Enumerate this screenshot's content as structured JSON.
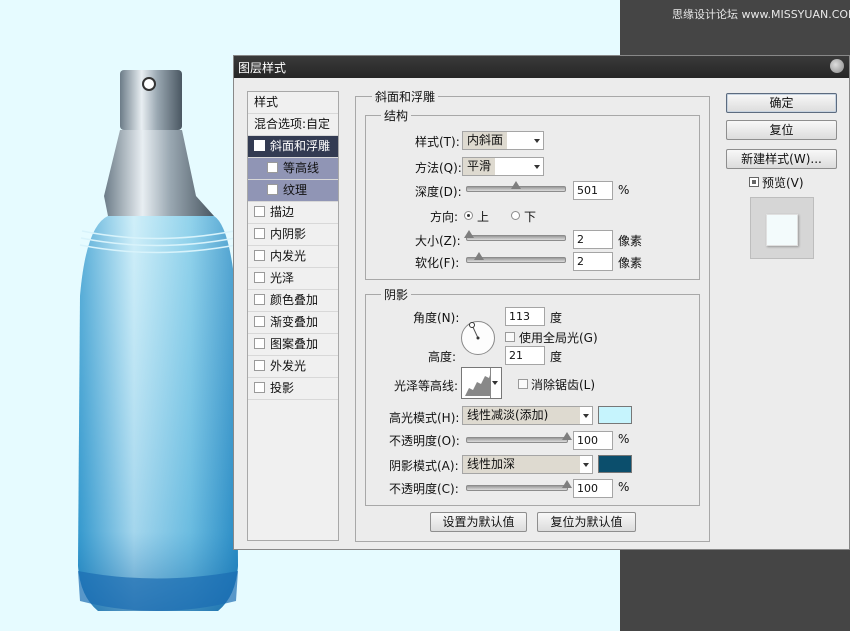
{
  "watermark": "思缘设计论坛 www.MISSYUAN.COM",
  "dialog": {
    "title": "图层样式"
  },
  "styles_panel": {
    "header": "样式",
    "blend_options": "混合选项:自定",
    "items": [
      {
        "label": "斜面和浮雕",
        "checked": true,
        "selected": true
      },
      {
        "label": "等高线",
        "checked": false,
        "sub": true
      },
      {
        "label": "纹理",
        "checked": false,
        "sub": true
      },
      {
        "label": "描边",
        "checked": false
      },
      {
        "label": "内阴影",
        "checked": false
      },
      {
        "label": "内发光",
        "checked": false
      },
      {
        "label": "光泽",
        "checked": false
      },
      {
        "label": "颜色叠加",
        "checked": false
      },
      {
        "label": "渐变叠加",
        "checked": false
      },
      {
        "label": "图案叠加",
        "checked": false
      },
      {
        "label": "外发光",
        "checked": false
      },
      {
        "label": "投影",
        "checked": false
      }
    ]
  },
  "bevel": {
    "section_title": "斜面和浮雕",
    "structure_title": "结构",
    "style_label": "样式(T):",
    "style_value": "内斜面",
    "technique_label": "方法(Q):",
    "technique_value": "平滑",
    "depth_label": "深度(D):",
    "depth_value": "501",
    "depth_unit": "%",
    "depth_slider_pct": 50,
    "direction_label": "方向:",
    "direction_up": "上",
    "direction_down": "下",
    "size_label": "大小(Z):",
    "size_value": "2",
    "size_unit": "像素",
    "size_slider_pct": 2,
    "soften_label": "软化(F):",
    "soften_value": "2",
    "soften_unit": "像素",
    "soften_slider_pct": 12
  },
  "shading": {
    "section_title": "阴影",
    "angle_label": "角度(N):",
    "angle_value": "113",
    "angle_unit": "度",
    "global_light_label": "使用全局光(G)",
    "altitude_label": "高度:",
    "altitude_value": "21",
    "altitude_unit": "度",
    "gloss_label": "光泽等高线:",
    "antialias_label": "消除锯齿(L)",
    "highlight_label": "高光模式(H):",
    "highlight_mode": "线性减淡(添加)",
    "highlight_color": "#c6f4fd",
    "highlight_opacity_label": "不透明度(O):",
    "highlight_opacity": "100",
    "opacity_unit": "%",
    "shadow_label": "阴影模式(A):",
    "shadow_mode": "线性加深",
    "shadow_color": "#0b4e6c",
    "shadow_opacity_label": "不透明度(C):",
    "shadow_opacity": "100"
  },
  "buttons": {
    "set_default": "设置为默认值",
    "reset_default": "复位为默认值",
    "ok": "确定",
    "reset": "复位",
    "new_style": "新建样式(W)...",
    "preview": "预览(V)"
  }
}
